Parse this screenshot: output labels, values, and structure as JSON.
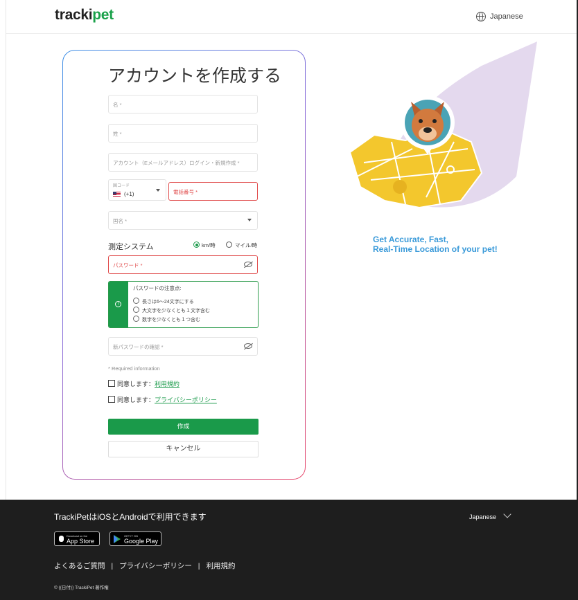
{
  "header": {
    "logo_text_a": "tracki",
    "logo_text_b": "pet",
    "language": "Japanese"
  },
  "form": {
    "title": "アカウントを作成する",
    "first_name_placeholder": "名 *",
    "last_name_placeholder": "姓 *",
    "account_placeholder": "アカウント（Eメールアドレス）ログイン・新規作成 *",
    "country_code_label": "国コード",
    "country_code_value": "(+1)",
    "phone_placeholder": "電話番号 *",
    "country_placeholder": "国名 *",
    "measurement_label": "測定システム",
    "measurement_options": [
      "km/時",
      "マイル/時"
    ],
    "measurement_selected": "km/時",
    "password_placeholder": "パスワード *",
    "password_hint_title": "パスワードの注意点:",
    "password_hints": [
      "長さは6～24文字にする",
      "大文字を少なくとも１文字含む",
      "数字を少なくとも１つ含む"
    ],
    "confirm_password_placeholder": "新パスワードの確認 *",
    "required_info": "* Required information",
    "agree_prefix": "同意します：",
    "terms_link": "利用規約",
    "privacy_link": "プライバシーポリシー",
    "create_button": "作成",
    "cancel_button": "キャンセル"
  },
  "hero": {
    "tagline_line1": "Get Accurate, Fast,",
    "tagline_line2": "Real-Time Location of your pet!"
  },
  "footer": {
    "availability": "TrackiPetはiOSとAndroidで利用できます",
    "language": "Japanese",
    "app_store_small": "Download on the",
    "app_store": "App Store",
    "google_play_small": "GET IT ON",
    "google_play": "Google Play",
    "links": [
      "よくあるご質問",
      "|",
      "プライバシーポリシー",
      "|",
      "利用規約"
    ],
    "copyright": "© {{日付}} TrackiPet 著作権"
  },
  "colors": {
    "brand_green": "#1a9a4a",
    "error_red": "#e04b4b",
    "tagline_blue": "#3a9ad9",
    "footer_bg": "#1e1e1e"
  }
}
